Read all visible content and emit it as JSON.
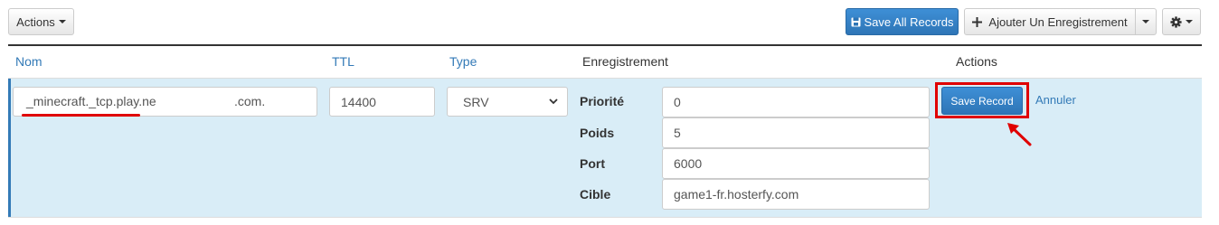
{
  "toolbar": {
    "actions_label": "Actions",
    "save_all_label": "Save All Records",
    "add_record_label": "Ajouter Un Enregistrement"
  },
  "table": {
    "headers": {
      "name": "Nom",
      "ttl": "TTL",
      "type": "Type",
      "record": "Enregistrement",
      "actions": "Actions"
    }
  },
  "row": {
    "name_value": "_minecraft._tcp.play.ne",
    "name_suffix": ".com.",
    "ttl_value": "14400",
    "type_value": "SRV",
    "fields": {
      "priority_label": "Priorité",
      "priority_value": "0",
      "weight_label": "Poids",
      "weight_value": "5",
      "port_label": "Port",
      "port_value": "6000",
      "target_label": "Cible",
      "target_value": "game1-fr.hosterfy.com"
    },
    "save_label": "Save Record",
    "cancel_label": "Annuler"
  },
  "colors": {
    "primary": "#337ab7",
    "row_bg": "#d9edf7",
    "highlight": "#e00000"
  },
  "icons": {
    "save": "floppy-disk-icon",
    "add": "plus-icon",
    "settings": "gear-icon"
  }
}
